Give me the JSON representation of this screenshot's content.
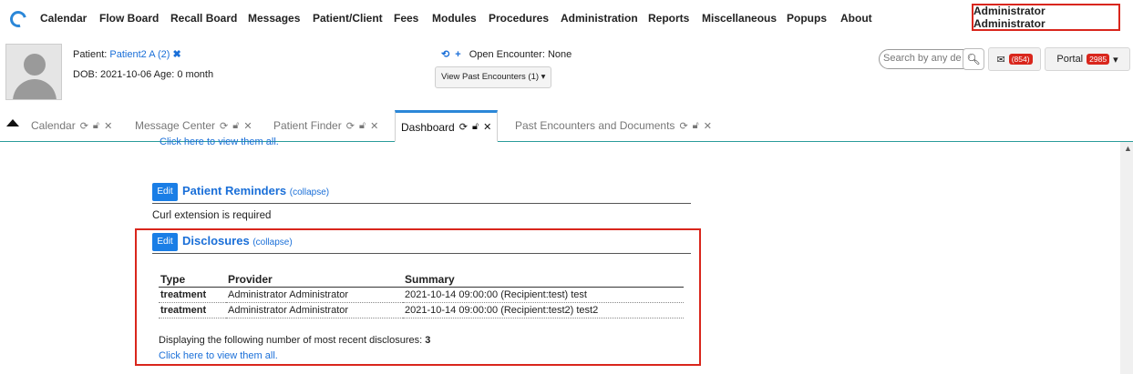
{
  "nav": {
    "items": [
      "Calendar",
      "Flow Board",
      "Recall Board",
      "Messages",
      "Patient/Client",
      "Fees",
      "Modules",
      "Procedures",
      "Administration",
      "Reports",
      "Miscellaneous",
      "Popups",
      "About"
    ],
    "user": "Administrator Administrator"
  },
  "patient": {
    "label": "Patient:",
    "name": "Patient2 A (2)",
    "dob_line": "DOB: 2021-10-06 Age: 0 month"
  },
  "encounter": {
    "open_label": "Open Encounter: None",
    "past_button": "View Past Encounters",
    "past_count": "(1)"
  },
  "search": {
    "placeholder": "Search by any de"
  },
  "messages": {
    "badge": "(854)"
  },
  "portal": {
    "label": "Portal",
    "badge": "2985"
  },
  "tabs": [
    {
      "label": "Calendar"
    },
    {
      "label": "Message Center"
    },
    {
      "label": "Patient Finder"
    },
    {
      "label": "Dashboard"
    },
    {
      "label": "Past Encounters and Documents"
    }
  ],
  "content": {
    "top_link": "Click here to view them all.",
    "reminders": {
      "edit": "Edit",
      "title": "Patient Reminders",
      "toggle": "(collapse)"
    },
    "curl_msg": "Curl extension is required",
    "disclosures": {
      "edit": "Edit",
      "title": "Disclosures",
      "toggle": "(collapse)",
      "headers": [
        "Type",
        "Provider",
        "Summary"
      ],
      "rows": [
        [
          "treatment",
          "Administrator Administrator",
          "2021-10-14 09:00:00 (Recipient:test) test"
        ],
        [
          "treatment",
          "Administrator Administrator",
          "2021-10-14 09:00:00 (Recipient:test2) test2"
        ]
      ],
      "count_label": "Displaying the following number of most recent disclosures:",
      "count_value": "3",
      "view_all": "Click here to view them all."
    }
  }
}
